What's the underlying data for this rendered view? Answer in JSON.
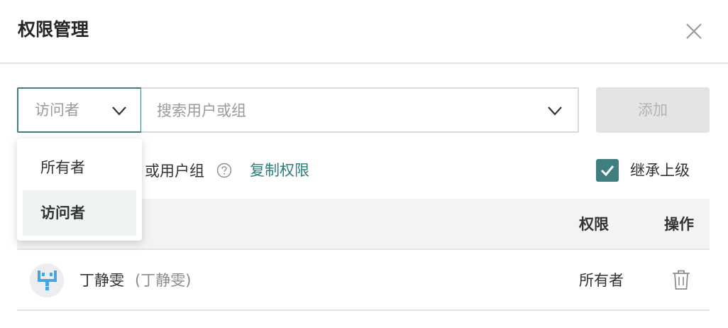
{
  "dialog": {
    "title": "权限管理",
    "close_icon": "close-icon"
  },
  "role_select": {
    "value": "访问者",
    "icon": "chevron-down-icon"
  },
  "search": {
    "placeholder": "搜索用户或组",
    "icon": "chevron-down-icon"
  },
  "add_button": {
    "label": "添加",
    "state": "disabled"
  },
  "row2": {
    "partial_text": "或用户组",
    "help_icon": "question-circle-icon",
    "copy_link": "复制权限"
  },
  "inherit": {
    "label": "继承上级",
    "checked": true
  },
  "table": {
    "headers": {
      "permission": "权限",
      "operation": "操作"
    },
    "rows": [
      {
        "name": "丁静雯",
        "sub": "(丁静雯)",
        "permission": "所有者",
        "action_icon": "trash-icon"
      }
    ]
  },
  "dropdown": {
    "options": [
      {
        "label": "所有者",
        "selected": false
      },
      {
        "label": "访问者",
        "selected": true
      }
    ]
  },
  "colors": {
    "accent": "#3f7f7f",
    "link": "#2d7d7d",
    "header_bg": "#f2f3f5",
    "disabled_button_bg": "#e3e4e6",
    "avatar_logo": "#4aa3df"
  }
}
